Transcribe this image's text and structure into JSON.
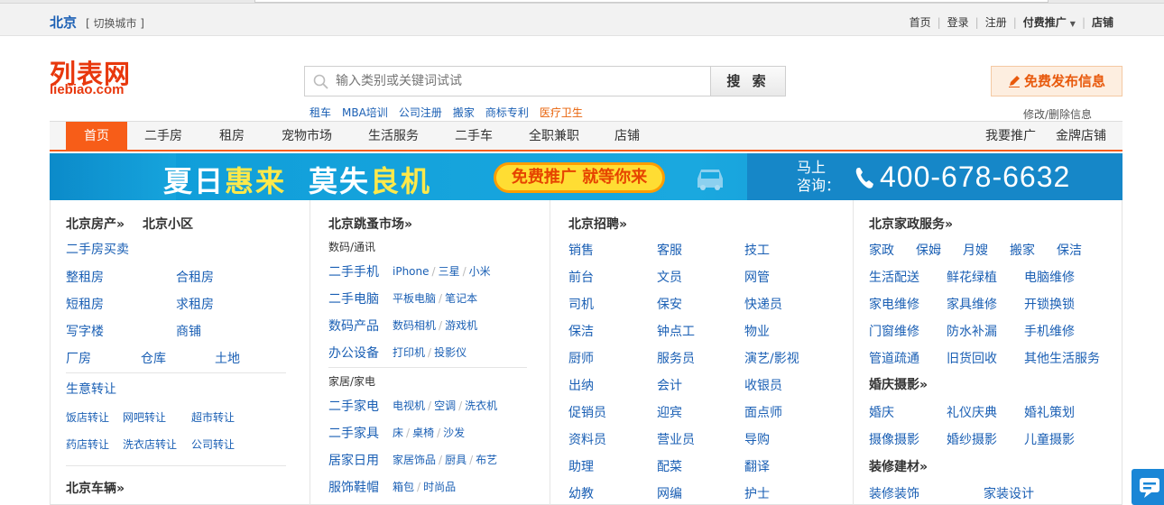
{
  "topbar": {
    "city": "北京",
    "switch_city": "[ 切换城市 ]",
    "links": [
      "首页",
      "登录",
      "注册"
    ],
    "paid_promo": "付费推广",
    "shop": "店铺"
  },
  "header": {
    "logo_cn": "列表网",
    "logo_en": "liebiao.com",
    "search_placeholder": "输入类别或关键词试试",
    "search_button": "搜 索",
    "hot_links": [
      "租车",
      "MBA培训",
      "公司注册",
      "搬家",
      "商标专利"
    ],
    "hot_link_highlight": "医疗卫生",
    "publish_button": "免费发布信息",
    "modify_link": "修改/删除信息"
  },
  "nav": {
    "items": [
      "首页",
      "二手房",
      "租房",
      "宠物市场",
      "生活服务",
      "二手车",
      "全职兼职",
      "店铺"
    ],
    "right_items": [
      "我要推广",
      "金牌店铺"
    ]
  },
  "banner": {
    "text1a": "夏日",
    "text1b": "惠来",
    "text2a": "莫失",
    "text2b": "良机",
    "pill": "免费推广 就等你来",
    "mashang_1": "马上",
    "mashang_2": "咨询：",
    "phone": "400-678-6632"
  },
  "col1": {
    "h1": "北京房产»",
    "h1b": "北京小区",
    "links_a": [
      "二手房买卖"
    ],
    "grid": [
      "整租房",
      "合租房",
      "短租房",
      "求租房",
      "写字楼",
      "商铺"
    ],
    "row3": [
      "厂房",
      "仓库",
      "土地"
    ],
    "transfer": "生意转让",
    "transfer_sub": [
      "饭店转让",
      "网吧转让",
      "超市转让",
      "药店转让",
      "洗衣店转让",
      "公司转让"
    ],
    "h2": "北京车辆»"
  },
  "col2": {
    "h1": "北京跳蚤市场»",
    "sub1": "数码/通讯",
    "rows1": [
      {
        "main": "二手手机",
        "subs": [
          "iPhone",
          "三星",
          "小米"
        ]
      },
      {
        "main": "二手电脑",
        "subs": [
          "平板电脑",
          "笔记本"
        ]
      },
      {
        "main": "数码产品",
        "subs": [
          "数码相机",
          "游戏机"
        ]
      },
      {
        "main": "办公设备",
        "subs": [
          "打印机",
          "投影仪"
        ]
      }
    ],
    "sub2": "家居/家电",
    "rows2": [
      {
        "main": "二手家电",
        "subs": [
          "电视机",
          "空调",
          "洗衣机"
        ]
      },
      {
        "main": "二手家具",
        "subs": [
          "床",
          "桌椅",
          "沙发"
        ]
      },
      {
        "main": "居家日用",
        "subs": [
          "家居饰品",
          "厨具",
          "布艺"
        ]
      },
      {
        "main": "服饰鞋帽",
        "subs": [
          "箱包",
          "时尚品"
        ]
      }
    ]
  },
  "col3": {
    "h1": "北京招聘»",
    "rows": [
      [
        "销售",
        "客服",
        "技工"
      ],
      [
        "前台",
        "文员",
        "网管"
      ],
      [
        "司机",
        "保安",
        "快递员"
      ],
      [
        "保洁",
        "钟点工",
        "物业"
      ],
      [
        "厨师",
        "服务员",
        "演艺/影视"
      ],
      [
        "出纳",
        "会计",
        "收银员"
      ],
      [
        "促销员",
        "迎宾",
        "面点师"
      ],
      [
        "资料员",
        "营业员",
        "导购"
      ],
      [
        "助理",
        "配菜",
        "翻译"
      ],
      [
        "幼教",
        "网编",
        "护士"
      ]
    ]
  },
  "col4": {
    "h1": "北京家政服务»",
    "row1": [
      "家政",
      "保姆",
      "月嫂",
      "搬家",
      "保洁"
    ],
    "rows": [
      [
        "生活配送",
        "鲜花绿植",
        "电脑维修"
      ],
      [
        "家电维修",
        "家具维修",
        "开锁换锁"
      ],
      [
        "门窗维修",
        "防水补漏",
        "手机维修"
      ],
      [
        "管道疏通",
        "旧货回收",
        "其他生活服务"
      ]
    ],
    "h2": "婚庆摄影»",
    "rows2": [
      [
        "婚庆",
        "礼仪庆典",
        "婚礼策划"
      ],
      [
        "摄像摄影",
        "婚纱摄影",
        "儿童摄影"
      ]
    ],
    "h3": "装修建材»",
    "rows3": [
      "装修装饰",
      "家装设计"
    ]
  }
}
